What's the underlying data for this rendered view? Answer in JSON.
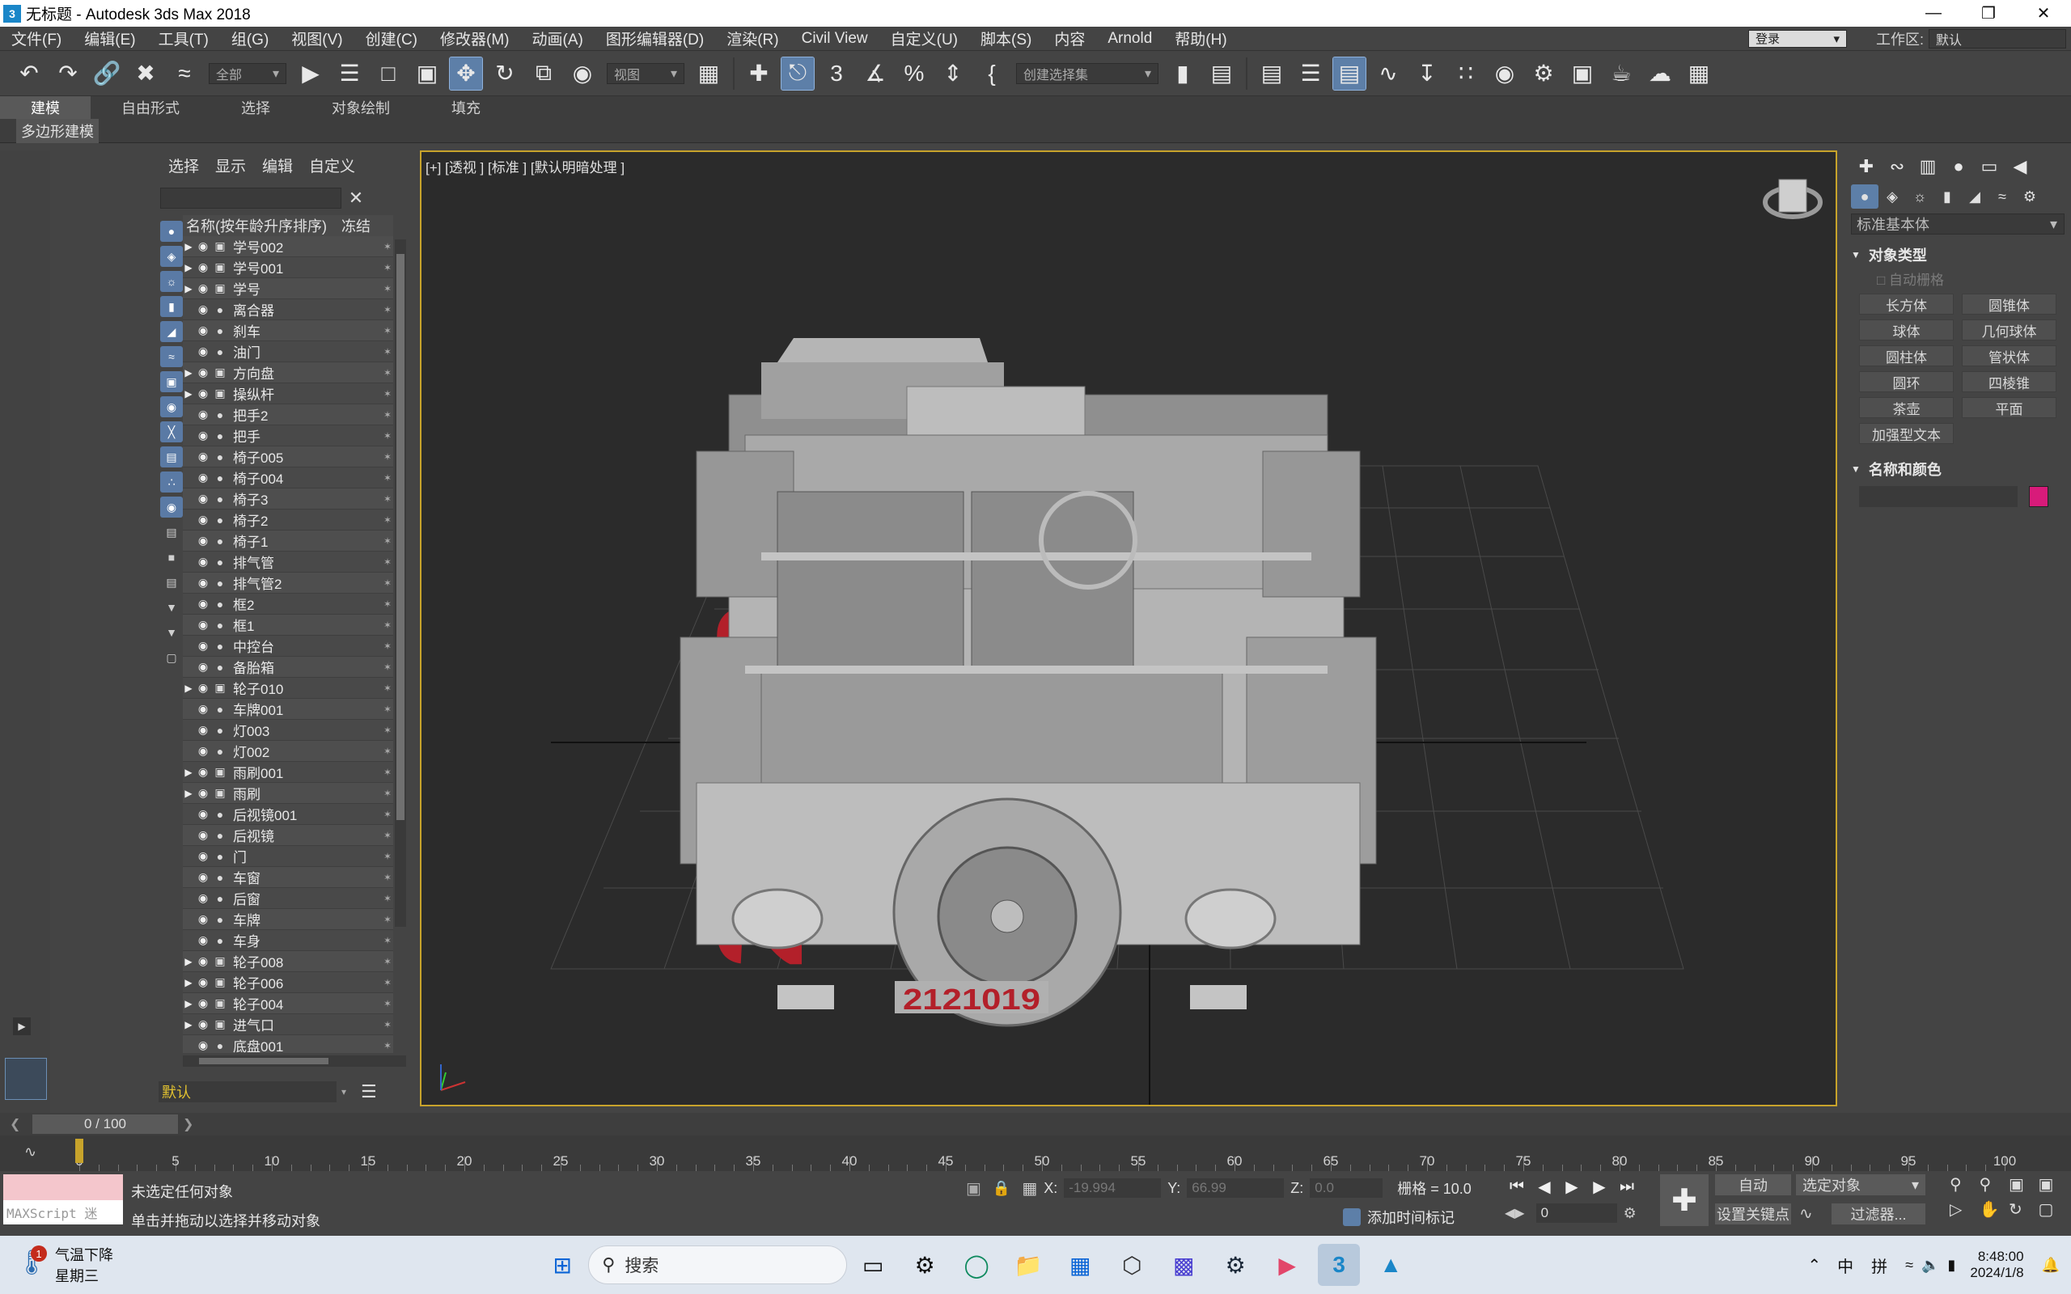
{
  "window": {
    "title": "无标题 - Autodesk 3ds Max 2018",
    "app_icon": "3"
  },
  "menu": [
    "文件(F)",
    "编辑(E)",
    "工具(T)",
    "组(G)",
    "视图(V)",
    "创建(C)",
    "修改器(M)",
    "动画(A)",
    "图形编辑器(D)",
    "渲染(R)",
    "Civil View",
    "自定义(U)",
    "脚本(S)",
    "内容",
    "Arnold",
    "帮助(H)"
  ],
  "account": {
    "login": "登录",
    "workspace_label": "工作区:",
    "workspace_value": "默认"
  },
  "toolbar": {
    "filter_value": "全部",
    "refcoord_value": "视图",
    "selset_placeholder": "创建选择集",
    "snap_label": "3"
  },
  "ribbon": {
    "tabs": [
      "建模",
      "自由形式",
      "选择",
      "对象绘制",
      "填充"
    ],
    "active_tab": "建模",
    "subtab": "多边形建模"
  },
  "scene_explorer": {
    "menus": [
      "选择",
      "显示",
      "编辑",
      "自定义"
    ],
    "col_name": "名称(按年龄升序排序)",
    "col_freeze": "冻结",
    "rows": [
      {
        "name": "学号002",
        "expand": true
      },
      {
        "name": "学号001",
        "expand": true
      },
      {
        "name": "学号",
        "expand": true
      },
      {
        "name": "离合器",
        "expand": false
      },
      {
        "name": "刹车",
        "expand": false
      },
      {
        "name": "油门",
        "expand": false
      },
      {
        "name": "方向盘",
        "expand": true
      },
      {
        "name": "操纵杆",
        "expand": true
      },
      {
        "name": "把手2",
        "expand": false
      },
      {
        "name": "把手",
        "expand": false
      },
      {
        "name": "椅子005",
        "expand": false
      },
      {
        "name": "椅子004",
        "expand": false
      },
      {
        "name": "椅子3",
        "expand": false
      },
      {
        "name": "椅子2",
        "expand": false
      },
      {
        "name": "椅子1",
        "expand": false
      },
      {
        "name": "排气管",
        "expand": false
      },
      {
        "name": "排气管2",
        "expand": false
      },
      {
        "name": "框2",
        "expand": false
      },
      {
        "name": "框1",
        "expand": false
      },
      {
        "name": "中控台",
        "expand": false
      },
      {
        "name": "备胎箱",
        "expand": false
      },
      {
        "name": "轮子010",
        "expand": true
      },
      {
        "name": "车牌001",
        "expand": false
      },
      {
        "name": "灯003",
        "expand": false
      },
      {
        "name": "灯002",
        "expand": false
      },
      {
        "name": "雨刷001",
        "expand": true
      },
      {
        "name": "雨刷",
        "expand": true
      },
      {
        "name": "后视镜001",
        "expand": false
      },
      {
        "name": "后视镜",
        "expand": false
      },
      {
        "name": "门",
        "expand": false
      },
      {
        "name": "车窗",
        "expand": false
      },
      {
        "name": "后窗",
        "expand": false
      },
      {
        "name": "车牌",
        "expand": false
      },
      {
        "name": "车身",
        "expand": false
      },
      {
        "name": "轮子008",
        "expand": true
      },
      {
        "name": "轮子006",
        "expand": true
      },
      {
        "name": "轮子004",
        "expand": true
      },
      {
        "name": "进气口",
        "expand": true
      },
      {
        "name": "底盘001",
        "expand": false
      }
    ],
    "layer": "默认"
  },
  "viewport": {
    "label": "[+] [透视 ] [标准 ] [默认明暗处理 ]",
    "ground_text": "2121019",
    "plate_text": "2121019",
    "accent": "#c7a32b"
  },
  "command_panel": {
    "dropdown": "标准基本体",
    "rollout_object_type": "对象类型",
    "autogrid": "自动栅格",
    "buttons": [
      "长方体",
      "圆锥体",
      "球体",
      "几何球体",
      "圆柱体",
      "管状体",
      "圆环",
      "四棱锥",
      "茶壶",
      "平面",
      "加强型文本"
    ],
    "rollout_name_color": "名称和颜色",
    "swatch_color": "#d81b7a"
  },
  "timeline": {
    "frame_display": "0 / 100",
    "current": 0,
    "max": 100,
    "labels": [
      0,
      5,
      10,
      15,
      20,
      25,
      30,
      35,
      40,
      45,
      50,
      55,
      60,
      65,
      70,
      75,
      80,
      85,
      90,
      95,
      100
    ]
  },
  "status": {
    "maxscript": "MAXScript 迷",
    "line1": "未选定任何对象",
    "line2": "单击并拖动以选择并移动对象",
    "x_label": "X:",
    "x_value": "-19.994",
    "y_label": "Y:",
    "y_value": "66.99",
    "z_label": "Z:",
    "z_value": "0.0",
    "grid": "栅格 = 10.0",
    "add_time_tag": "添加时间标记",
    "auto_key": "自动",
    "set_key": "设置关键点",
    "selected_object": "选定对象",
    "filters": "过滤器...",
    "frame_field": "0"
  },
  "taskbar": {
    "weather_title": "气温下降",
    "weather_sub": "星期三",
    "weather_badge": "1",
    "search": "搜索",
    "ime1": "中",
    "ime2": "拼",
    "time": "8:48:00",
    "date": "2024/1/8"
  }
}
